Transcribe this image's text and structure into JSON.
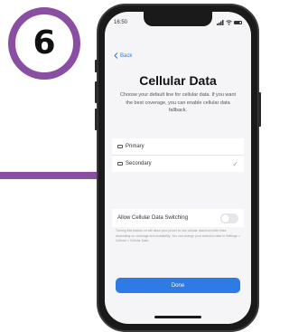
{
  "step": {
    "number": "6"
  },
  "colors": {
    "badge_ring": "#8a4fa3",
    "accent": "#2f7be5"
  },
  "status_bar": {
    "time": "16:50"
  },
  "nav": {
    "back_label": "Back"
  },
  "page": {
    "title": "Cellular Data",
    "subtitle": "Choose your default line for cellular data. If you want the best coverage, you can enable cellular data fallback."
  },
  "lines": [
    {
      "label": "Primary",
      "selected": false
    },
    {
      "label": "Secondary",
      "selected": true
    }
  ],
  "switching": {
    "label": "Allow Cellular Data Switching",
    "enabled": false
  },
  "footnote": "Turning this feature on will allow your phone to use cellular data from both lines depending on coverage and availability. You can change your selection later in Settings > Cellular > Cellular Data.",
  "done_button": {
    "label": "Done"
  }
}
